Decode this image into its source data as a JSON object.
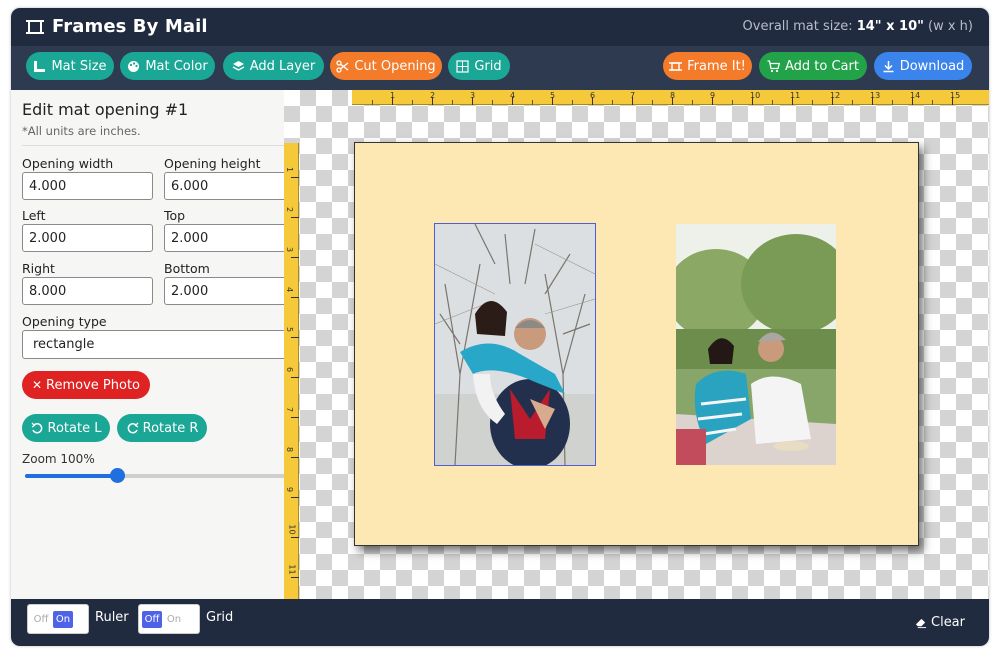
{
  "app": {
    "title": "Frames By Mail",
    "mat_size_prefix": "Overall mat size: ",
    "mat_size_value": "14\" x 10\"",
    "mat_size_suffix": " (w x h)"
  },
  "toolbar": {
    "mat_size": "Mat Size",
    "mat_color": "Mat Color",
    "add_layer": "Add Layer",
    "cut_opening": "Cut Opening",
    "grid": "Grid",
    "frame_it": "Frame It!",
    "add_to_cart": "Add to Cart",
    "download": "Download"
  },
  "panel": {
    "heading": "Edit mat opening #1",
    "note": "*All units are inches.",
    "fields": {
      "opening_width": {
        "label": "Opening width",
        "value": "4.000"
      },
      "opening_height": {
        "label": "Opening height",
        "value": "6.000"
      },
      "left": {
        "label": "Left",
        "value": "2.000"
      },
      "top": {
        "label": "Top",
        "value": "2.000"
      },
      "right": {
        "label": "Right",
        "value": "8.000"
      },
      "bottom": {
        "label": "Bottom",
        "value": "2.000"
      }
    },
    "opening_type": {
      "label": "Opening type",
      "value": "rectangle"
    },
    "remove_photo": "Remove Photo",
    "rotate_left": "Rotate L",
    "rotate_right": "Rotate R",
    "zoom_label": "Zoom 100%",
    "zoom_value": 0.35
  },
  "ruler": {
    "top_labels": [
      "1",
      "2",
      "3",
      "4",
      "5",
      "6",
      "7",
      "8",
      "9",
      "10",
      "11",
      "12",
      "13",
      "14",
      "15"
    ],
    "left_labels": [
      "1",
      "2",
      "3",
      "4",
      "5",
      "6",
      "7",
      "8",
      "9",
      "10",
      "11"
    ]
  },
  "mat": {
    "color": "#fde8b4",
    "openings": [
      "photo-1",
      "photo-2"
    ]
  },
  "bottom": {
    "ruler_toggle": {
      "off": "Off",
      "on": "On",
      "state": "on",
      "label": "Ruler"
    },
    "grid_toggle": {
      "off": "Off",
      "on": "On",
      "state": "off",
      "label": "Grid"
    },
    "clear": "Clear"
  },
  "colors": {
    "header": "#212b3f",
    "toolbar": "#2e3a4f",
    "teal": "#1aa796",
    "orange": "#f47b2a",
    "green": "#22a34a",
    "blue": "#3a84ec",
    "red": "#df2323",
    "ruler": "#f6c93a"
  }
}
